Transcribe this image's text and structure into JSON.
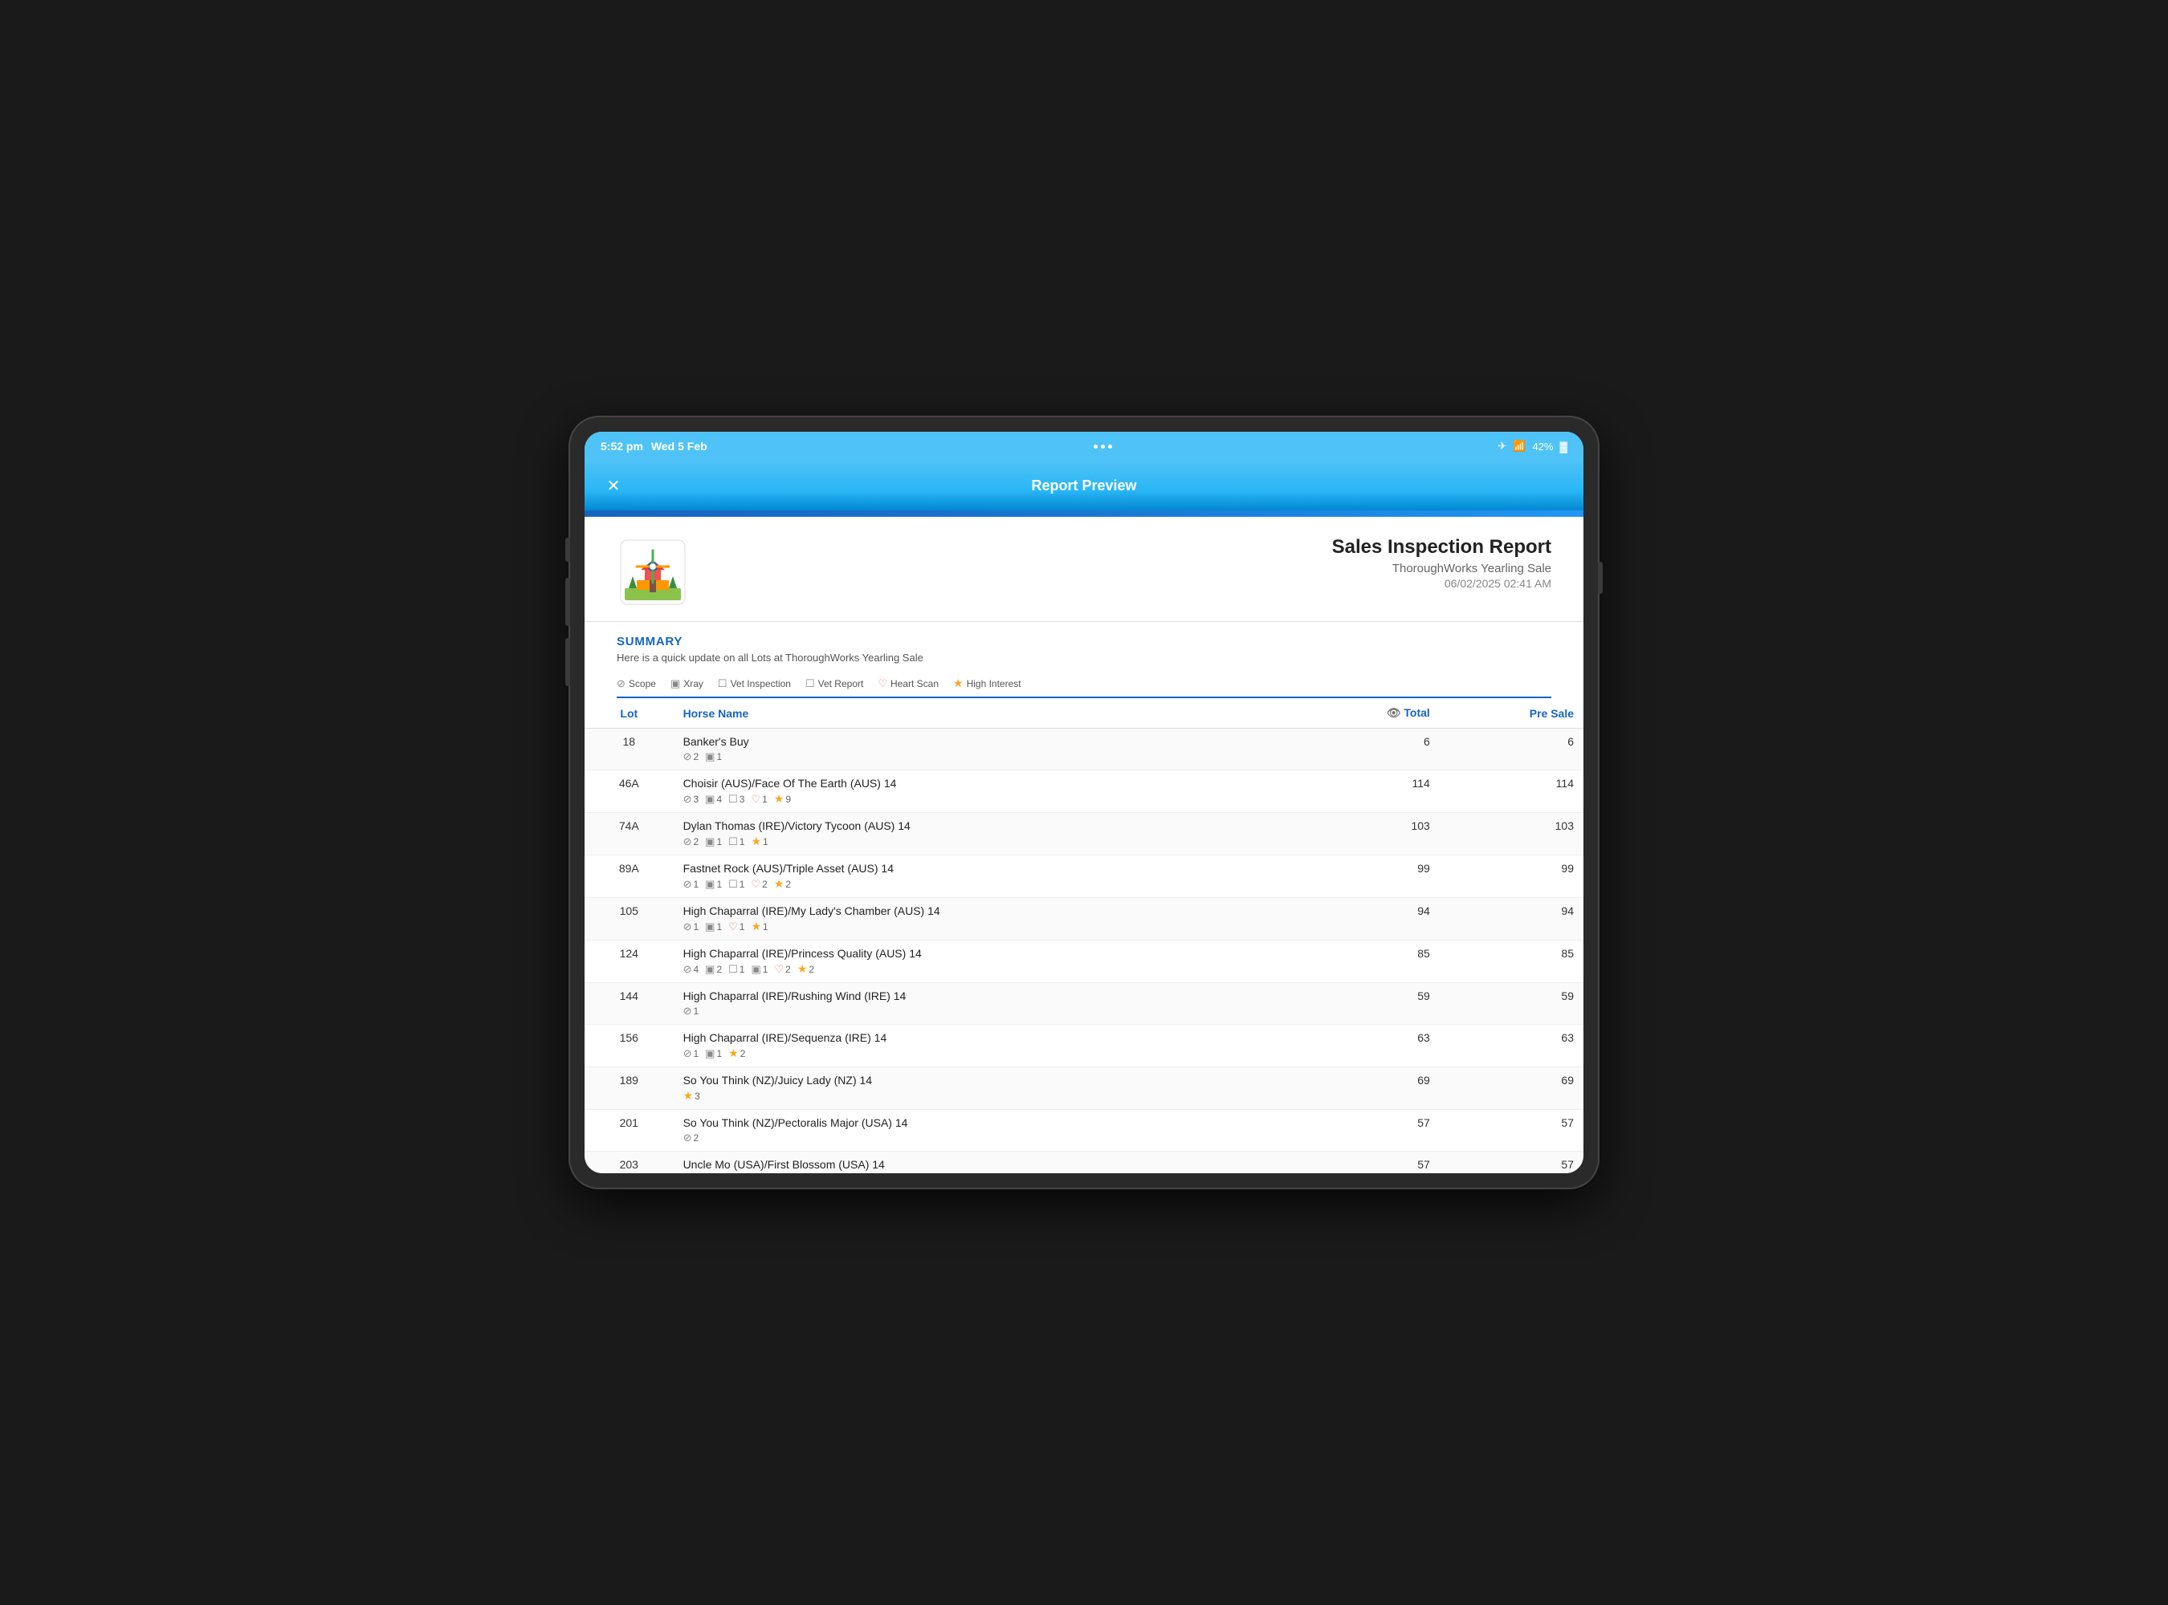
{
  "status_bar": {
    "time": "5:52 pm",
    "date": "Wed 5 Feb",
    "battery": "42%"
  },
  "nav": {
    "title": "Report Preview",
    "close_label": "✕"
  },
  "report": {
    "main_title": "Sales Inspection Report",
    "subtitle": "ThoroughWorks Yearling Sale",
    "date": "06/02/2025 02:41 AM"
  },
  "summary": {
    "title": "SUMMARY",
    "description": "Here is a quick update on all Lots at ThoroughWorks Yearling Sale"
  },
  "legend": {
    "items": [
      {
        "icon": "⊘",
        "label": "Scope"
      },
      {
        "icon": "▣",
        "label": "Xray"
      },
      {
        "icon": "☐",
        "label": "Vet Inspection"
      },
      {
        "icon": "☐",
        "label": "Vet Report"
      },
      {
        "icon": "♡",
        "label": "Heart Scan"
      },
      {
        "icon": "★",
        "label": "High Interest"
      }
    ]
  },
  "table": {
    "headers": {
      "lot": "Lot",
      "horse_name": "Horse Name",
      "total": "Total",
      "pre_sale": "Pre Sale"
    },
    "rows": [
      {
        "lot": "18",
        "name": "Banker's Buy",
        "icons": [
          {
            "type": "scope",
            "count": "2"
          },
          {
            "type": "xray",
            "count": "1"
          }
        ],
        "total": "6",
        "pre_sale": "6"
      },
      {
        "lot": "46A",
        "name": "Choisir (AUS)/Face Of The Earth (AUS) 14",
        "icons": [
          {
            "type": "scope",
            "count": "3"
          },
          {
            "type": "xray",
            "count": "4"
          },
          {
            "type": "vet",
            "count": "3"
          },
          {
            "type": "heart",
            "count": "1"
          },
          {
            "type": "star",
            "count": "9"
          }
        ],
        "total": "114",
        "pre_sale": "114"
      },
      {
        "lot": "74A",
        "name": "Dylan Thomas (IRE)/Victory Tycoon (AUS) 14",
        "icons": [
          {
            "type": "scope",
            "count": "2"
          },
          {
            "type": "xray",
            "count": "1"
          },
          {
            "type": "vet",
            "count": "1"
          },
          {
            "type": "star",
            "count": "1"
          }
        ],
        "total": "103",
        "pre_sale": "103"
      },
      {
        "lot": "89A",
        "name": "Fastnet Rock (AUS)/Triple Asset (AUS) 14",
        "icons": [
          {
            "type": "scope",
            "count": "1"
          },
          {
            "type": "xray",
            "count": "1"
          },
          {
            "type": "vet",
            "count": "1"
          },
          {
            "type": "heart",
            "count": "2"
          },
          {
            "type": "star",
            "count": "2"
          }
        ],
        "total": "99",
        "pre_sale": "99"
      },
      {
        "lot": "105",
        "name": "High Chaparral (IRE)/My Lady's Chamber (AUS) 14",
        "icons": [
          {
            "type": "scope",
            "count": "1"
          },
          {
            "type": "xray",
            "count": "1"
          },
          {
            "type": "heart",
            "count": "1"
          },
          {
            "type": "star",
            "count": "1"
          }
        ],
        "total": "94",
        "pre_sale": "94"
      },
      {
        "lot": "124",
        "name": "High Chaparral (IRE)/Princess Quality (AUS) 14",
        "icons": [
          {
            "type": "scope",
            "count": "4"
          },
          {
            "type": "xray",
            "count": "2"
          },
          {
            "type": "vet",
            "count": "1"
          },
          {
            "type": "xray2",
            "count": "1"
          },
          {
            "type": "heart",
            "count": "2"
          },
          {
            "type": "star",
            "count": "2"
          }
        ],
        "total": "85",
        "pre_sale": "85"
      },
      {
        "lot": "144",
        "name": "High Chaparral (IRE)/Rushing Wind (IRE) 14",
        "icons": [
          {
            "type": "scope",
            "count": "1"
          }
        ],
        "total": "59",
        "pre_sale": "59"
      },
      {
        "lot": "156",
        "name": "High Chaparral (IRE)/Sequenza (IRE) 14",
        "icons": [
          {
            "type": "scope",
            "count": "1"
          },
          {
            "type": "xray",
            "count": "1"
          },
          {
            "type": "star",
            "count": "2"
          }
        ],
        "total": "63",
        "pre_sale": "63"
      },
      {
        "lot": "189",
        "name": "So You Think (NZ)/Juicy Lady (NZ) 14",
        "icons": [
          {
            "type": "star",
            "count": "3"
          }
        ],
        "total": "69",
        "pre_sale": "69"
      },
      {
        "lot": "201",
        "name": "So You Think (NZ)/Pectoralis Major (USA) 14",
        "icons": [
          {
            "type": "scope",
            "count": "2"
          }
        ],
        "total": "57",
        "pre_sale": "57"
      },
      {
        "lot": "203",
        "name": "Uncle Mo (USA)/First Blossom (USA) 14",
        "icons": [],
        "total": "57",
        "pre_sale": "57"
      }
    ]
  }
}
